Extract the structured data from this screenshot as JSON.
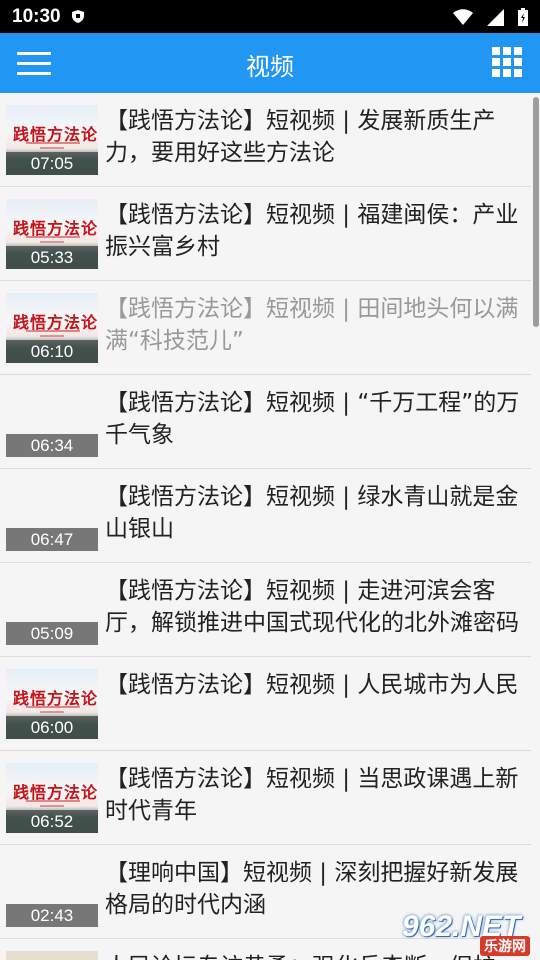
{
  "status": {
    "time": "10:30"
  },
  "header": {
    "title": "视频"
  },
  "items": [
    {
      "duration": "07:05",
      "text": "【践悟方法论】短视频 | 发展新质生产力，要用好这些方法论",
      "read": false
    },
    {
      "duration": "05:33",
      "text": "【践悟方法论】短视频 | 福建闽侯：产业振兴富乡村",
      "read": false
    },
    {
      "duration": "06:10",
      "text": "【践悟方法论】短视频 | 田间地头何以满满“科技范儿”",
      "read": true
    },
    {
      "duration": "06:34",
      "text": "【践悟方法论】短视频 | “千万工程”的万千气象",
      "read": false
    },
    {
      "duration": "06:47",
      "text": "【践悟方法论】短视频 | 绿水青山就是金山银山",
      "read": false
    },
    {
      "duration": "05:09",
      "text": "【践悟方法论】短视频 | 走进河滨会客厅，解锁推进中国式现代化的北外滩密码",
      "read": false
    },
    {
      "duration": "06:00",
      "text": "【践悟方法论】短视频 | 人民城市为人民",
      "read": false
    },
    {
      "duration": "06:52",
      "text": "【践悟方法论】短视频 | 当思政课遇上新时代青年",
      "read": false
    },
    {
      "duration": "02:43",
      "text": "【理响中国】短视频 | 深刻把握好新发展格局的时代内涵",
      "read": false
    },
    {
      "text": "人民论坛专访黄勇：强化兵森断一促护"
    }
  ],
  "thumb_text": {
    "brand": "践悟方法论"
  },
  "watermark": {
    "big": "962.NET",
    "small": "乐游网"
  },
  "colors": {
    "appbar": "#2196f3",
    "read_text": "#999999",
    "brand_red": "#c6141b"
  }
}
